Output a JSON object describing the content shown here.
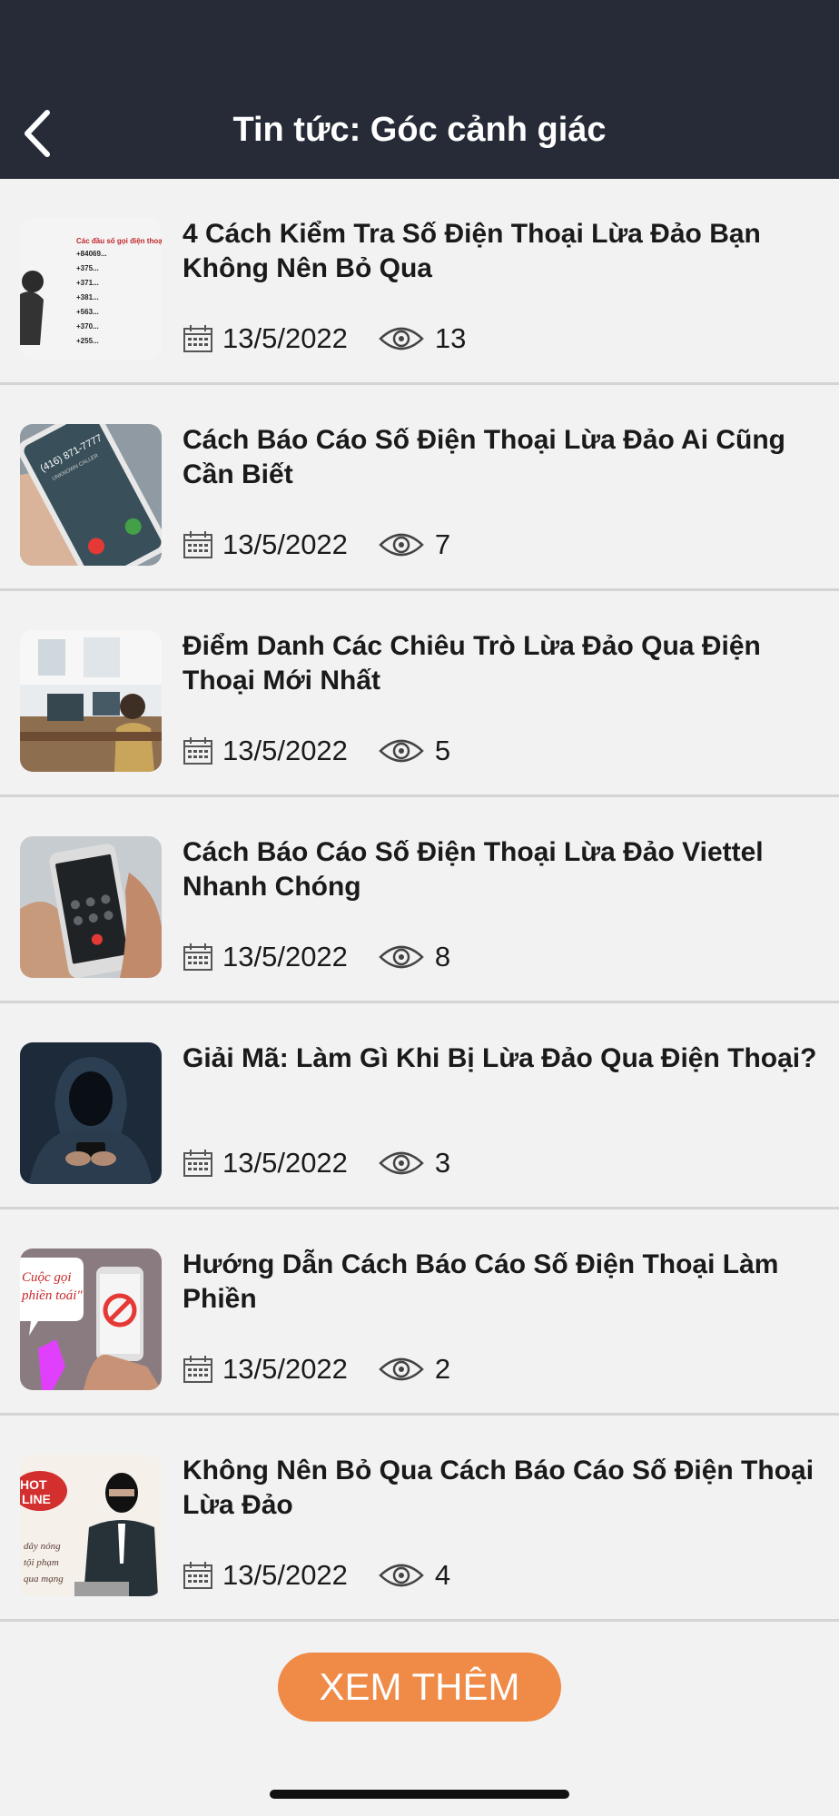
{
  "header": {
    "title": "Tin tức: Góc cảnh giác",
    "back_icon": "chevron-left-icon"
  },
  "articles": [
    {
      "title": "4 Cách Kiểm Tra Số Điện Thoại Lừa Đảo Bạn Không Nên Bỏ Qua",
      "date": "13/5/2022",
      "views": "13",
      "thumb_text": [
        "Các đầu số gọi điện thoại",
        "+84069...",
        "+375...",
        "+371...",
        "+381...",
        "+563...",
        "+370...",
        "+255..."
      ]
    },
    {
      "title": "Cách Báo Cáo Số Điện Thoại Lừa Đảo Ai Cũng Cần Biết",
      "date": "13/5/2022",
      "views": "7",
      "thumb_text": [
        "(416) 871-7777",
        "UNKNOWN CALLER"
      ]
    },
    {
      "title": "Điểm Danh Các Chiêu Trò Lừa Đảo Qua Điện Thoại Mới Nhất",
      "date": "13/5/2022",
      "views": "5"
    },
    {
      "title": "Cách Báo Cáo Số Điện Thoại Lừa Đảo Viettel Nhanh Chóng",
      "date": "13/5/2022",
      "views": "8"
    },
    {
      "title": "Giải Mã: Làm Gì Khi Bị Lừa Đảo Qua Điện Thoại?",
      "date": "13/5/2022",
      "views": "3"
    },
    {
      "title": "Hướng Dẫn Cách Báo Cáo Số Điện Thoại Làm Phiền",
      "date": "13/5/2022",
      "views": "2",
      "thumb_text": [
        "Cuộc gọi",
        "phiền toái\""
      ]
    },
    {
      "title": "Không Nên Bỏ Qua Cách Báo Cáo Số Điện Thoại Lừa Đảo",
      "date": "13/5/2022",
      "views": "4",
      "thumb_text": [
        "HOT",
        "LINE",
        "dây nóng",
        "tội phạm",
        "qua mạng"
      ]
    }
  ],
  "icons": {
    "date": "calendar-icon",
    "views": "eye-icon"
  },
  "load_more": {
    "label": "XEM THÊM"
  },
  "colors": {
    "header_bg": "#262b37",
    "accent": "#ef8b47",
    "page_bg": "#f2f2f2"
  }
}
